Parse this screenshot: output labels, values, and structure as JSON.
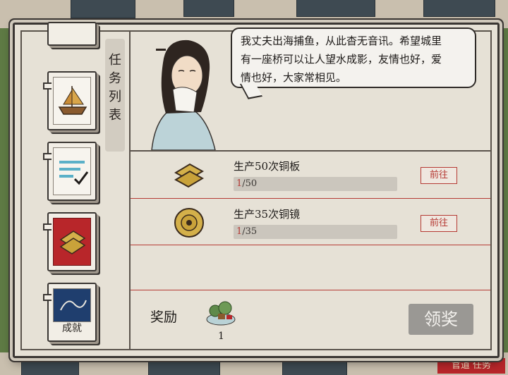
{
  "dialogue": {
    "text_line1": "我丈夫出海捕鱼，从此杳无音讯。希望城里",
    "text_line2": "有一座桥可以让人望水成影，友情也好，爱",
    "text_line3": "情也好，大家常相见。"
  },
  "sidebar": {
    "title_chars": [
      "任",
      "务",
      "列",
      "表"
    ],
    "tabs": [
      {
        "name": "top-partial"
      },
      {
        "name": "boat"
      },
      {
        "name": "list-check"
      },
      {
        "name": "copper",
        "active": true
      },
      {
        "name": "achievement",
        "label": "成就"
      }
    ]
  },
  "quests": [
    {
      "title": "生产50次铜板",
      "current": "1",
      "total": "/50",
      "button": "前往"
    },
    {
      "title": "生产35次铜镜",
      "current": "1",
      "total": "/35",
      "button": "前往"
    }
  ],
  "reward": {
    "label": "奖励",
    "count": "1",
    "claim_button": "领奖"
  },
  "colors": {
    "accent_red": "#b53a34",
    "panel_bg": "#e6e1d6",
    "claim_disabled": "#9a9894"
  },
  "bottom_right_sign": "官道 任务"
}
